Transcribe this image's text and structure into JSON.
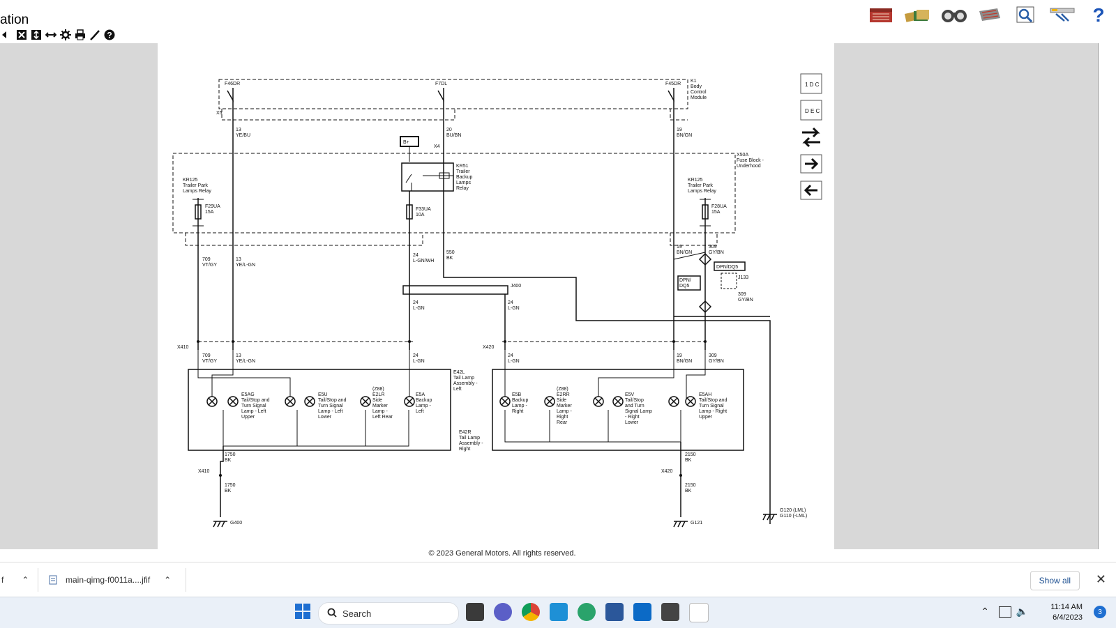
{
  "app": {
    "title_fragment": "ation"
  },
  "copyright": "© 2023 General Motors.  All rights reserved.",
  "downloads": {
    "partial_item": "f",
    "item_label": "main-qimg-f0011a....jfif",
    "show_all_label": "Show all"
  },
  "taskbar": {
    "search_label": "Search",
    "time": "11:14 AM",
    "date": "6/4/2023",
    "notification_count": "3"
  },
  "diagram": {
    "bcm": {
      "label": "K1\nBody\nControl\nModule",
      "pin_left": "F46DR",
      "pin_mid": "F7DL",
      "pin_right": "F45DR",
      "conn_x5": "X5",
      "conn_x4": "X4"
    },
    "fuse_block": {
      "label": "X50A\nFuse Block -\nUnderhood"
    },
    "relay_left": {
      "label": "KR125\nTrailer Park\nLamps Relay",
      "fuse": "F29UA\n15A"
    },
    "relay_right": {
      "label": "KR125\nTrailer Park\nLamps Relay",
      "fuse": "F28UA\n15A"
    },
    "relay_backup": {
      "label": "KR51\nTrailer\nBackup\nLamps\nRelay",
      "fuse": "F33UA\n10A",
      "bplus": "B+"
    },
    "wires": {
      "w1": "13\nYE/BU",
      "w2": "20\nBU/BN",
      "w3": "19\nBN/GN",
      "w4": "709\nVT/GY",
      "w5": "13\nYE/L-GN",
      "w6": "24\nL-GN/WH",
      "w7": "550\nBK",
      "w8": "19\nBN/GN",
      "w9": "309\nGY/BN",
      "w10": "24\nL-GN",
      "w11": "24\nL-GN",
      "w12": "709\nVT/GY",
      "w13": "13\nYE/L-GN",
      "w14": "24\nL-GN",
      "w15": "24\nL-GN",
      "w16": "19\nBN/GN",
      "w17": "309\nGY/BN",
      "w18": "309\nGY/BN",
      "w19": "1750\nBK",
      "w20": "1750\nBK",
      "w21": "2150\nBK",
      "w22": "2150\nBK"
    },
    "splice": "J400",
    "dpn_left": "DPN/\nDQ5",
    "dpn_right": "DPN/DQ5",
    "j133": "J133",
    "connectors": {
      "x410_top": "X410",
      "x420_top": "X420",
      "x410_bot": "X410",
      "x420_bot": "X420"
    },
    "assembly_left": "E42L\nTail Lamp\nAssembly -\nLeft",
    "assembly_right": "E42R\nTail Lamp\nAssembly -\nRight",
    "lamps": {
      "e5ag": "E5AG\nTail/Stop and\nTurn Signal\nLamp - Left\nUpper",
      "e5u": "E5U\nTail/Stop and\nTurn Signal\nLamp - Left\nLower",
      "e2lr": "(Z88)\nE2LR\nSide\nMarker\nLamp -\nLeft Rear",
      "e5a": "E5A\nBackup\nLamp -\nLeft",
      "e5b": "E5B\nBackup\nLamp -\nRight",
      "e2rr": "(Z88)\nE2RR\nSide\nMarker\nLamp -\nRight\nRear",
      "e5v": "E5V\nTail/Stop\nand Turn\nSignal Lamp\n- Right\nLower",
      "e5ah": "E5AH\nTail/Stop and\nTurn Signal\nLamp - Right\nUpper"
    },
    "grounds": {
      "g400": "G400",
      "g121": "G121",
      "g120": "G120  (LML)\nG110  (-LML)"
    }
  },
  "icons": {
    "view_tools": [
      "fit-icon",
      "fit-window-icon",
      "fit-height-icon",
      "fit-width-icon",
      "settings-icon",
      "print-icon",
      "highlight-icon",
      "help-icon"
    ],
    "top_toolbar": [
      "home-icon",
      "manuals-icon",
      "search-binoculars-icon",
      "calculator-icon",
      "document-search-icon",
      "tools-icon",
      "help-icon"
    ],
    "diagram_side": [
      "legend-icon",
      "legend-2-icon",
      "navigate-icon",
      "next-arrow-icon",
      "prev-arrow-icon"
    ]
  },
  "colors": {
    "content_bg": "#d8d8d8",
    "taskbar_bg": "#eaf0f8",
    "link_blue": "#1a4d8f"
  }
}
